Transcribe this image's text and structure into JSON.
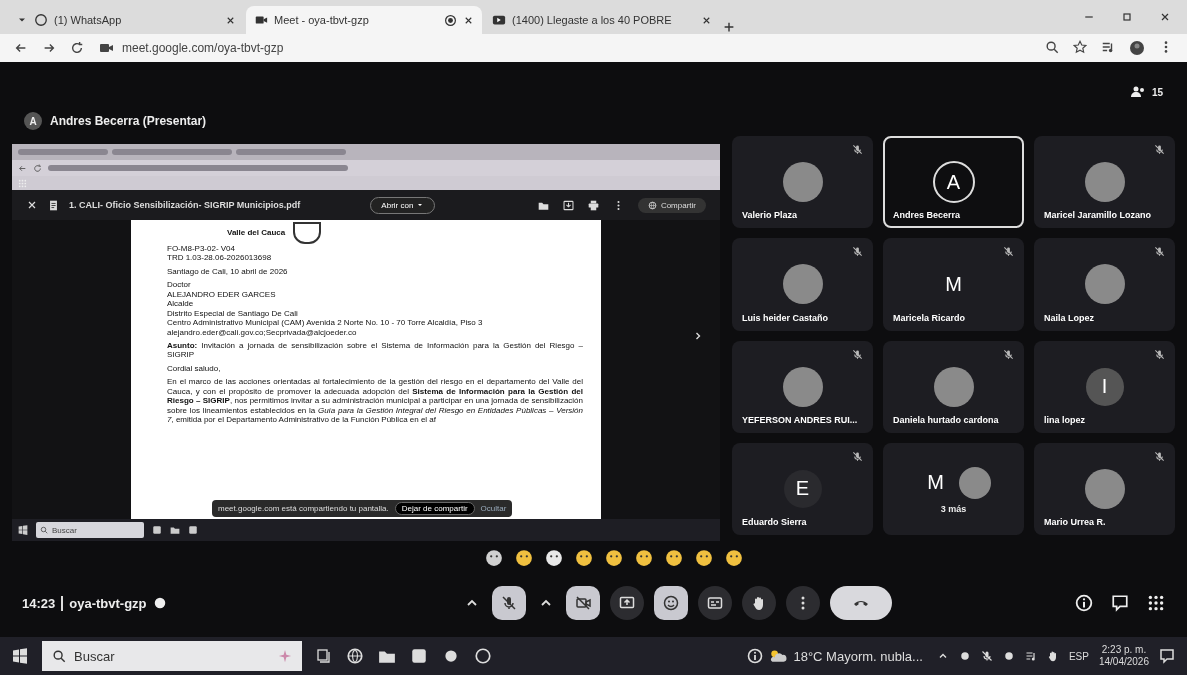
{
  "browser": {
    "tabs": [
      {
        "title": "(1) WhatsApp",
        "selected": false
      },
      {
        "title": "Meet - oya-tbvt-gzp",
        "selected": true,
        "recording": true
      },
      {
        "title": "(1400) Llegaste a los 40 POBRE",
        "selected": false
      }
    ],
    "url": "meet.google.com/oya-tbvt-gzp"
  },
  "meet": {
    "presenter": {
      "initial": "A",
      "label": "Andres Becerra (Presentar)"
    },
    "participant_count": "15",
    "shared_screen": {
      "pdf_title": "1. CALI- Oficio Sensibilización- SIGRIP Municipios.pdf",
      "open_with": "Abrir con",
      "share": "Compartir",
      "document": {
        "letterhead": "Valle del Cauca",
        "lines": [
          {
            "kind": "code",
            "text": "FO-M8-P3-02- V04"
          },
          {
            "kind": "code",
            "text": "TRD 1.03-28.06-2026013698"
          },
          {
            "kind": "gap"
          },
          {
            "kind": "line",
            "text": "Santiago de Cali, 10 abril de 2026"
          },
          {
            "kind": "gap"
          },
          {
            "kind": "line",
            "text": "Doctor"
          },
          {
            "kind": "line",
            "text": "ALEJANDRO EDER GARCES"
          },
          {
            "kind": "line",
            "text": "Alcalde"
          },
          {
            "kind": "line",
            "text": "Distrito Especial de Santiago De Cali"
          },
          {
            "kind": "line",
            "text": "Centro Administrativo Municipal (CAM) Avenida 2 Norte No. 10 - 70 Torre Alcaldía, Piso 3"
          },
          {
            "kind": "line",
            "text": "alejandro.eder@cali.gov.co;Secprivada@alcjoeder.co"
          },
          {
            "kind": "gap"
          },
          {
            "kind": "para",
            "text": "**Asunto:** Invitación a jornada de sensibilización sobre el Sistema de Información para la Gestión del Riesgo – SIGRIP"
          },
          {
            "kind": "gap"
          },
          {
            "kind": "line",
            "text": "Cordial saludo,"
          },
          {
            "kind": "gap"
          },
          {
            "kind": "para",
            "text": "En el marco de las acciones orientadas al fortalecimiento de la gestión del riesgo en el departamento del Valle del Cauca, y con el propósito de promover la adecuada adopción del **Sistema de Información para la Gestión del Riesgo – SIGRIP**, nos permitimos invitar a su administración municipal a participar en una jornada de sensibilización sobre los lineamientos establecidos en la *Guía para la Gestión Integral del Riesgo en Entidades Públicas – Versión 7*, emitida por el Departamento Administrativo de la Función Pública en el af"
          }
        ]
      },
      "share_banner": {
        "message": "meet.google.com está compartiendo tu pantalla.",
        "stop": "Dejar de compartir",
        "hide": "Ocultar"
      },
      "taskbar": {
        "search": "Buscar"
      }
    },
    "tiles": [
      {
        "name": "Valerio Plaza",
        "kind": "photo",
        "muted": true,
        "highlighted": false
      },
      {
        "name": "Andres Becerra",
        "kind": "letter",
        "initial": "A",
        "muted": false,
        "highlighted": true
      },
      {
        "name": "Maricel Jaramillo Lozano",
        "kind": "photo",
        "muted": true,
        "highlighted": false
      },
      {
        "name": "Luis heider Castaño",
        "kind": "photo",
        "muted": true,
        "highlighted": false
      },
      {
        "name": "Maricela Ricardo",
        "kind": "letter",
        "initial": "M",
        "muted": true,
        "highlighted": false
      },
      {
        "name": "Naila Lopez",
        "kind": "photo",
        "muted": true,
        "highlighted": false
      },
      {
        "name": "YEFERSON ANDRES RUI...",
        "kind": "photo",
        "muted": true,
        "highlighted": false
      },
      {
        "name": "Daniela hurtado cardona",
        "kind": "photo",
        "muted": true,
        "highlighted": false
      },
      {
        "name": "lina lopez",
        "kind": "letter",
        "initial": "I",
        "muted": true,
        "highlighted": false
      },
      {
        "name": "Eduardo Sierra",
        "kind": "letter",
        "initial": "E",
        "muted": true,
        "highlighted": false
      },
      {
        "name": "3 más",
        "kind": "overflow",
        "initial": "M",
        "muted": false,
        "highlighted": false
      },
      {
        "name": "Mario Urrea R.",
        "kind": "photo",
        "muted": true,
        "highlighted": false
      }
    ],
    "meeting_time": "14:23",
    "meeting_code": "oya-tbvt-gzp",
    "controls": [
      {
        "kind": "caret",
        "highlighted": false
      },
      {
        "kind": "mic-off",
        "highlighted": true
      },
      {
        "kind": "caret",
        "highlighted": false
      },
      {
        "kind": "camera-off",
        "highlighted": true
      },
      {
        "kind": "present",
        "highlighted": false
      },
      {
        "kind": "emoji",
        "highlighted": true
      },
      {
        "kind": "captions",
        "highlighted": false
      },
      {
        "kind": "hand",
        "highlighted": false
      },
      {
        "kind": "more",
        "highlighted": false
      },
      {
        "kind": "end-call"
      }
    ]
  },
  "taskbar": {
    "search": "Buscar",
    "weather": "18°C  Mayorm. nubla...",
    "language": "ESP",
    "time": "2:23 p. m.",
    "date": "14/04/2026"
  }
}
